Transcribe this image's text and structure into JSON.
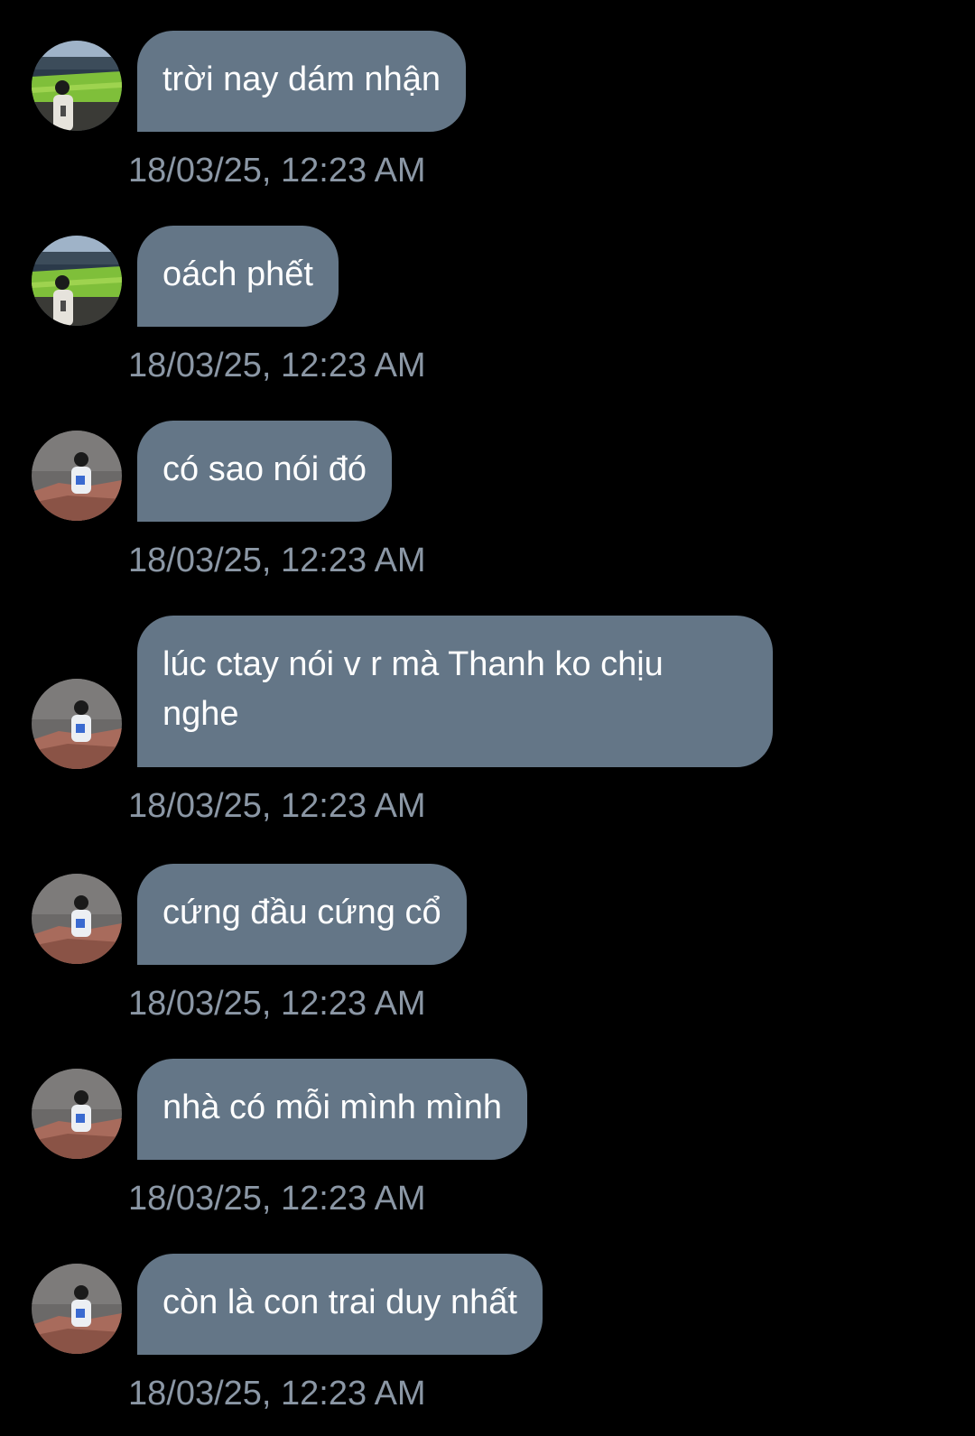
{
  "colors": {
    "background": "#000000",
    "bubble": "#647687",
    "bubble_text": "#ffffff",
    "timestamp": "#8b97a5"
  },
  "messages": [
    {
      "avatar": "stadium-avatar-icon",
      "text": "trời nay dám nhận",
      "time": "18/03/25, 12:23 AM"
    },
    {
      "avatar": "stadium-avatar-icon",
      "text": "oách phết",
      "time": "18/03/25, 12:23 AM"
    },
    {
      "avatar": "cliff-avatar-icon",
      "text": "có sao nói đó",
      "time": "18/03/25, 12:23 AM"
    },
    {
      "avatar": "cliff-avatar-icon",
      "text": "lúc ctay nói v r mà Thanh ko chịu nghe",
      "time": "18/03/25, 12:23 AM"
    },
    {
      "avatar": "cliff-avatar-icon",
      "text": "cứng đầu cứng cổ",
      "time": "18/03/25, 12:23 AM"
    },
    {
      "avatar": "cliff-avatar-icon",
      "text": "nhà có mỗi mình mình",
      "time": "18/03/25, 12:23 AM"
    },
    {
      "avatar": "cliff-avatar-icon",
      "text": "còn là con trai duy nhất",
      "time": "18/03/25, 12:23 AM"
    }
  ]
}
